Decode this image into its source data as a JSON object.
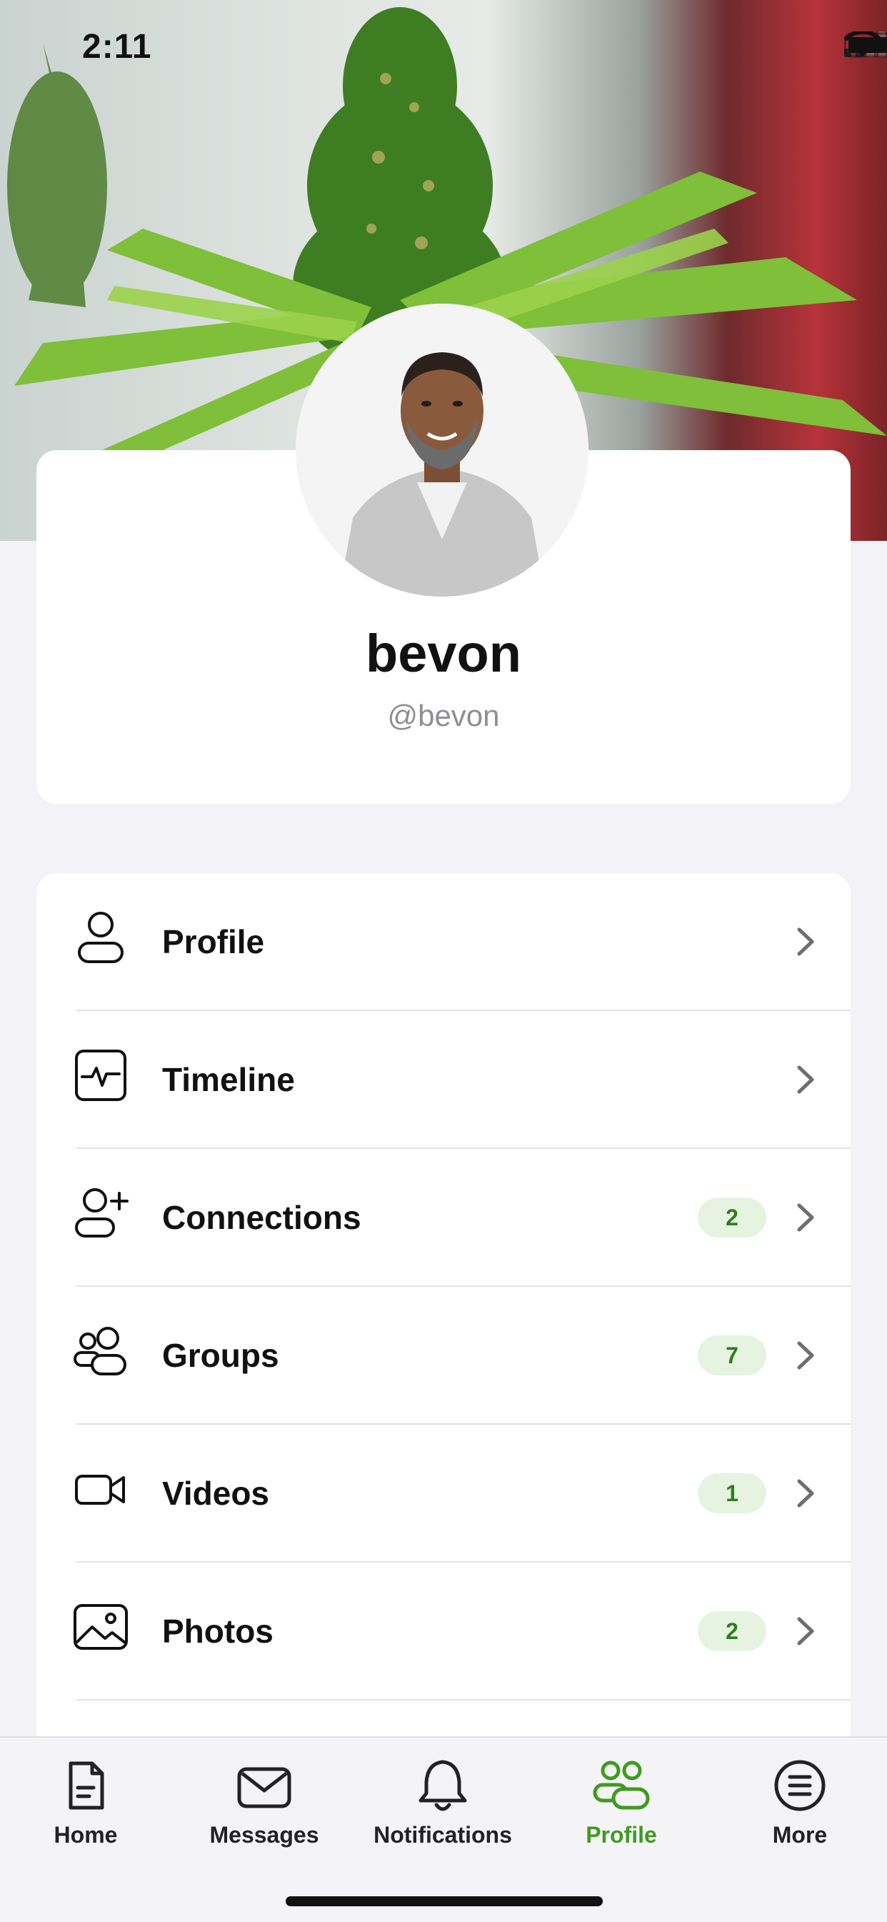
{
  "status_bar": {
    "time": "2:11"
  },
  "profile": {
    "display_name": "bevon",
    "handle": "@bevon"
  },
  "menu": {
    "items": [
      {
        "label": "Profile",
        "icon": "person-icon",
        "badge": ""
      },
      {
        "label": "Timeline",
        "icon": "activity-icon",
        "badge": ""
      },
      {
        "label": "Connections",
        "icon": "person-add-icon",
        "badge": "2"
      },
      {
        "label": "Groups",
        "icon": "group-icon",
        "badge": "7"
      },
      {
        "label": "Videos",
        "icon": "video-camera-icon",
        "badge": "1"
      },
      {
        "label": "Photos",
        "icon": "photo-icon",
        "badge": "2"
      }
    ]
  },
  "tabbar": {
    "tabs": [
      {
        "label": "Home",
        "icon": "document-icon",
        "active": false
      },
      {
        "label": "Messages",
        "icon": "envelope-icon",
        "active": false
      },
      {
        "label": "Notifications",
        "icon": "bell-icon",
        "active": false
      },
      {
        "label": "Profile",
        "icon": "people-icon",
        "active": true
      },
      {
        "label": "More",
        "icon": "menu-circle-icon",
        "active": false
      }
    ]
  },
  "colors": {
    "accent": "#3f9a22",
    "badge_bg": "#e6f3e1",
    "badge_text": "#2f7d1f",
    "background": "#f2f2f7"
  }
}
